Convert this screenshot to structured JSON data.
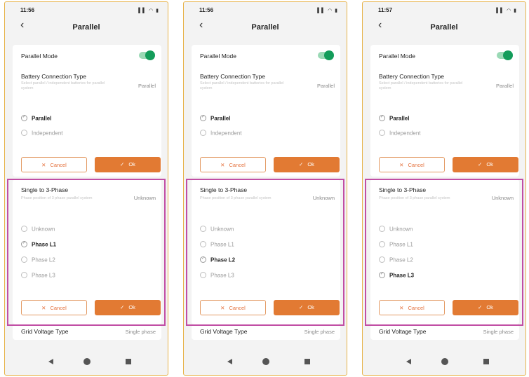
{
  "phones": [
    {
      "time": "11:56",
      "status_icons": "▌▌ ◠ ▮",
      "back_icon": "‹",
      "title": "Parallel",
      "parallel_mode": {
        "label": "Parallel Mode",
        "enabled": true
      },
      "battery_connection": {
        "label": "Battery Connection Type",
        "value": "Parallel",
        "desc": "Select parallel / independent batteries for parallel system",
        "options": [
          "Parallel",
          "Independent"
        ],
        "selected": 0,
        "cancel": "Cancel",
        "ok": "Ok"
      },
      "single_to_3phase": {
        "label": "Single to 3-Phase",
        "value": "Unknown",
        "desc": "Phase position of 3 phase parallel system",
        "options": [
          "Unknown",
          "Phase L1",
          "Phase L2",
          "Phase L3"
        ],
        "selected": 1,
        "cancel": "Cancel",
        "ok": "Ok"
      },
      "grid_voltage": {
        "label": "Grid Voltage Type",
        "value": "Single phase"
      }
    },
    {
      "time": "11:56",
      "status_icons": "▌▌ ◠ ▮",
      "back_icon": "‹",
      "title": "Parallel",
      "parallel_mode": {
        "label": "Parallel Mode",
        "enabled": true
      },
      "battery_connection": {
        "label": "Battery Connection Type",
        "value": "Parallel",
        "desc": "Select parallel / independent batteries for parallel system",
        "options": [
          "Parallel",
          "Independent"
        ],
        "selected": 0,
        "cancel": "Cancel",
        "ok": "Ok"
      },
      "single_to_3phase": {
        "label": "Single to 3-Phase",
        "value": "Unknown",
        "desc": "Phase position of 3 phase parallel system",
        "options": [
          "Unknown",
          "Phase L1",
          "Phase L2",
          "Phase L3"
        ],
        "selected": 2,
        "cancel": "Cancel",
        "ok": "Ok"
      },
      "grid_voltage": {
        "label": "Grid Voltage Type",
        "value": "Single phase"
      }
    },
    {
      "time": "11:57",
      "status_icons": "▌▌ ◠ ▮",
      "back_icon": "‹",
      "title": "Parallel",
      "parallel_mode": {
        "label": "Parallel Mode",
        "enabled": true
      },
      "battery_connection": {
        "label": "Battery Connection Type",
        "value": "Parallel",
        "desc": "Select parallel / independent batteries for parallel system",
        "options": [
          "Parallel",
          "Independent"
        ],
        "selected": 0,
        "cancel": "Cancel",
        "ok": "Ok"
      },
      "single_to_3phase": {
        "label": "Single to 3-Phase",
        "value": "Unknown",
        "desc": "Phase position of 3 phase parallel system",
        "options": [
          "Unknown",
          "Phase L1",
          "Phase L2",
          "Phase L3"
        ],
        "selected": 3,
        "cancel": "Cancel",
        "ok": "Ok"
      },
      "grid_voltage": {
        "label": "Grid Voltage Type",
        "value": "Single phase"
      }
    }
  ],
  "icons": {
    "cancel": "✕",
    "ok": "✓"
  },
  "colors": {
    "accent": "#e27a33",
    "toggle_on": "#139c5a",
    "highlight": "#c14ea4"
  }
}
